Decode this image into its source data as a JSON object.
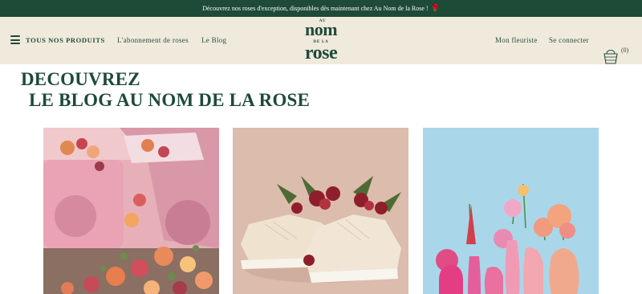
{
  "announcement": {
    "text": "Découvrez nos roses d'exception, disponibles dès maintenant chez Au Nom de la Rose !",
    "emoji": "🌹"
  },
  "header": {
    "menu_label": "TOUS NOS PRODUITS",
    "nav": {
      "subscription": "L'abonnement de roses",
      "blog": "Le Blog",
      "florist": "Mon fleuriste",
      "login": "Se connecter"
    },
    "logo": {
      "au": "AU",
      "nom": "nom",
      "de_la": "DE LA",
      "rose": "rose"
    },
    "cart_count": "(0)"
  },
  "page": {
    "title_line1": "DECOUVREZ",
    "title_line2": "LE BLOG AU NOM DE LA ROSE"
  },
  "colors": {
    "brand_green": "#1e4a38",
    "header_bg": "#efeadb"
  },
  "icons": {
    "menu": "hamburger-icon",
    "cart": "basket-icon"
  }
}
